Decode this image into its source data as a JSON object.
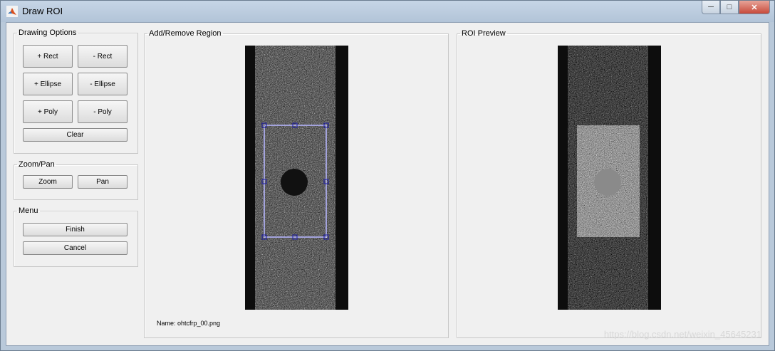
{
  "window": {
    "title": "Draw ROI"
  },
  "drawing_options": {
    "legend": "Drawing Options",
    "add_rect": "+ Rect",
    "remove_rect": "- Rect",
    "add_ellipse": "+ Ellipse",
    "remove_ellipse": "- Ellipse",
    "add_poly": "+ Poly",
    "remove_poly": "- Poly",
    "clear": "Clear"
  },
  "zoom_pan": {
    "legend": "Zoom/Pan",
    "zoom": "Zoom",
    "pan": "Pan"
  },
  "menu": {
    "legend": "Menu",
    "finish": "Finish",
    "cancel": "Cancel"
  },
  "add_remove_region": {
    "legend": "Add/Remove Region",
    "name_label": "Name: ohtcfrp_00.png"
  },
  "roi_preview": {
    "legend": "ROI Preview"
  },
  "watermark": "https://blog.csdn.net/weixin_45645231",
  "colors": {
    "roi_handle": "#1a1aa8",
    "roi_box": "#ffffff"
  }
}
